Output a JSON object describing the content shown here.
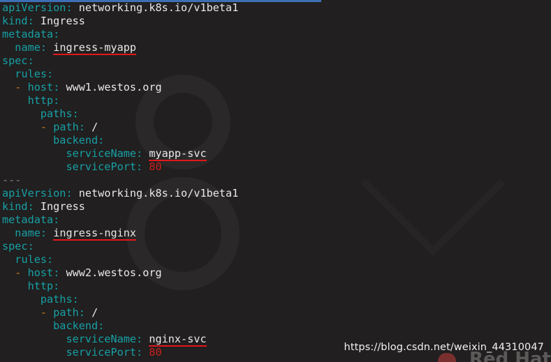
{
  "document": {
    "lines": [
      {
        "indent": "",
        "dash": "",
        "key": "apiVersion",
        "value": "networking.k8s.io/v1beta1",
        "type": "str",
        "underline": false
      },
      {
        "indent": "",
        "dash": "",
        "key": "kind",
        "value": "Ingress",
        "type": "str",
        "underline": false
      },
      {
        "indent": "",
        "dash": "",
        "key": "metadata",
        "value": "",
        "type": "str",
        "underline": false
      },
      {
        "indent": "  ",
        "dash": "",
        "key": "name",
        "value": "ingress-myapp",
        "type": "str",
        "underline": true
      },
      {
        "indent": "",
        "dash": "",
        "key": "spec",
        "value": "",
        "type": "str",
        "underline": false
      },
      {
        "indent": "  ",
        "dash": "",
        "key": "rules",
        "value": "",
        "type": "str",
        "underline": false
      },
      {
        "indent": "  ",
        "dash": "-",
        "key": "host",
        "value": "www1.westos.org",
        "type": "str",
        "underline": false
      },
      {
        "indent": "    ",
        "dash": "",
        "key": "http",
        "value": "",
        "type": "str",
        "underline": false
      },
      {
        "indent": "      ",
        "dash": "",
        "key": "paths",
        "value": "",
        "type": "str",
        "underline": false
      },
      {
        "indent": "      ",
        "dash": "-",
        "key": "path",
        "value": "/",
        "type": "str",
        "underline": false
      },
      {
        "indent": "        ",
        "dash": "",
        "key": "backend",
        "value": "",
        "type": "str",
        "underline": false
      },
      {
        "indent": "          ",
        "dash": "",
        "key": "serviceName",
        "value": "myapp-svc",
        "type": "str",
        "underline": true
      },
      {
        "indent": "          ",
        "dash": "",
        "key": "servicePort",
        "value": "80",
        "type": "num",
        "underline": false
      },
      {
        "indent": "",
        "dash": "",
        "key": "",
        "value": "---",
        "type": "sep",
        "underline": false
      },
      {
        "indent": "",
        "dash": "",
        "key": "apiVersion",
        "value": "networking.k8s.io/v1beta1",
        "type": "str",
        "underline": false
      },
      {
        "indent": "",
        "dash": "",
        "key": "kind",
        "value": "Ingress",
        "type": "str",
        "underline": false
      },
      {
        "indent": "",
        "dash": "",
        "key": "metadata",
        "value": "",
        "type": "str",
        "underline": false
      },
      {
        "indent": "  ",
        "dash": "",
        "key": "name",
        "value": "ingress-nginx",
        "type": "str",
        "underline": true
      },
      {
        "indent": "",
        "dash": "",
        "key": "spec",
        "value": "",
        "type": "str",
        "underline": false
      },
      {
        "indent": "  ",
        "dash": "",
        "key": "rules",
        "value": "",
        "type": "str",
        "underline": false
      },
      {
        "indent": "  ",
        "dash": "-",
        "key": "host",
        "value": "www2.westos.org",
        "type": "str",
        "underline": false
      },
      {
        "indent": "    ",
        "dash": "",
        "key": "http",
        "value": "",
        "type": "str",
        "underline": false
      },
      {
        "indent": "      ",
        "dash": "",
        "key": "paths",
        "value": "",
        "type": "str",
        "underline": false
      },
      {
        "indent": "      ",
        "dash": "-",
        "key": "path",
        "value": "/",
        "type": "str",
        "underline": false
      },
      {
        "indent": "        ",
        "dash": "",
        "key": "backend",
        "value": "",
        "type": "str",
        "underline": false
      },
      {
        "indent": "          ",
        "dash": "",
        "key": "serviceName",
        "value": "nginx-svc",
        "type": "str",
        "underline": true
      },
      {
        "indent": "          ",
        "dash": "",
        "key": "servicePort",
        "value": "80",
        "type": "num",
        "underline": false
      }
    ]
  },
  "watermark": {
    "url_text": "https://blog.csdn.net/weixin_44310047"
  },
  "wallpaper": {
    "brand_partial": "Red Hat"
  },
  "colors": {
    "background": "#211f1f",
    "key": "#17a0a6",
    "value": "#e9e9e9",
    "number": "#cc1f1f",
    "dash": "#c9791e",
    "underline": "#e2171c",
    "accent_bar": "#3c6fb4"
  }
}
